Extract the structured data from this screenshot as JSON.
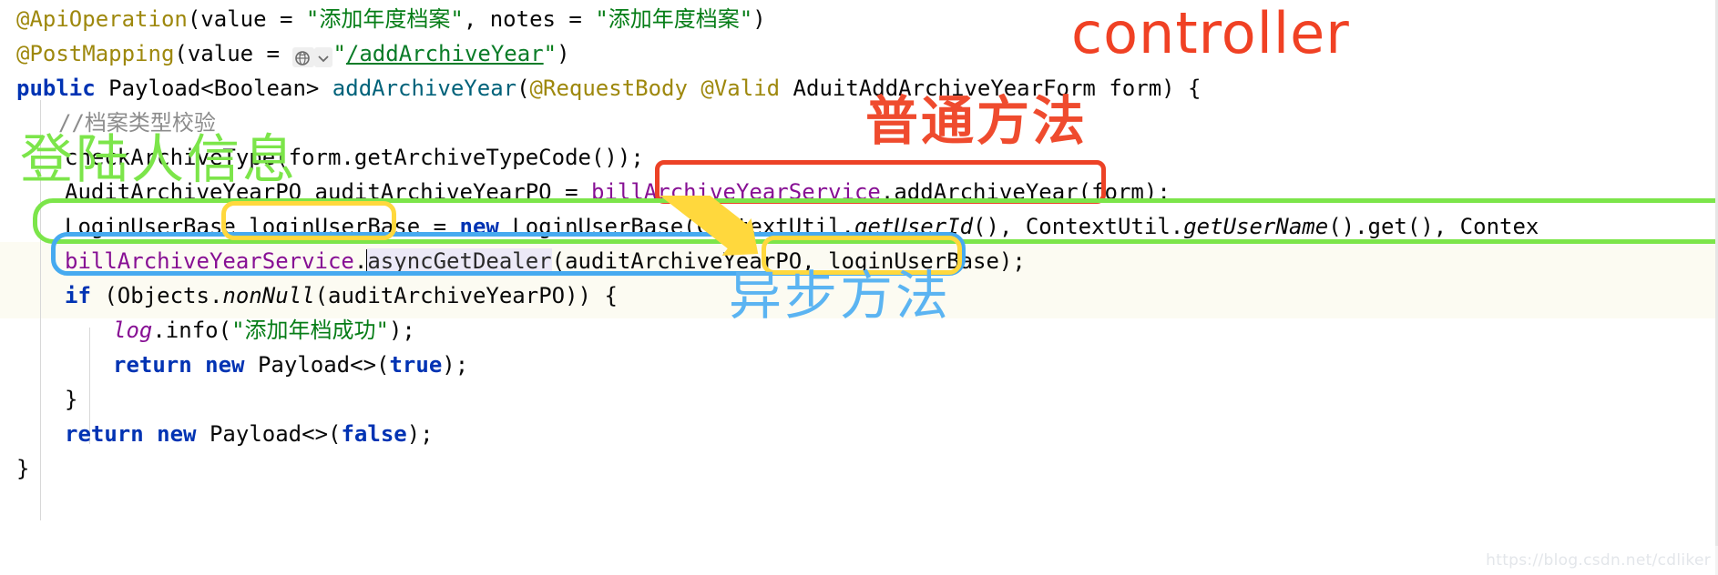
{
  "editor": {
    "language": "java",
    "code_lines": [
      {
        "id": "l1",
        "text": "@ApiOperation(value = \"添加年度档案\", notes = \"添加年度档案\")"
      },
      {
        "id": "l2",
        "text": "@PostMapping(value = \"/addArchiveYear\")"
      },
      {
        "id": "l3",
        "text": "public Payload<Boolean> addArchiveYear(@RequestBody @Valid AduitAddArchiveYearForm form) {"
      },
      {
        "id": "l4",
        "text": "//档案类型校验"
      },
      {
        "id": "l5",
        "text": "checkArchiveType(form.getArchiveTypeCode());"
      },
      {
        "id": "l6",
        "text": "AuditArchiveYearPO auditArchiveYearPO = billArchiveYearService.addArchiveYear(form);"
      },
      {
        "id": "l7",
        "text": "LoginUserBase loginUserBase = new LoginUserBase(ContextUtil.getUserId(), ContextUtil.getUserName().get(), Contex"
      },
      {
        "id": "l8",
        "text": "billArchiveYearService.asyncGetDealer(auditArchiveYearPO, loginUserBase);"
      },
      {
        "id": "l9",
        "text": "if (Objects.nonNull(auditArchiveYearPO)) {"
      },
      {
        "id": "l10",
        "text": "log.info(\"添加年档成功\");"
      },
      {
        "id": "l11",
        "text": "return new Payload<>(true);"
      },
      {
        "id": "l12",
        "text": "}"
      },
      {
        "id": "l13",
        "text": "return new Payload<>(false);"
      },
      {
        "id": "l14",
        "text": "}"
      }
    ],
    "tokens": {
      "ann_api_operation": "@ApiOperation",
      "ann_post_mapping": "@PostMapping",
      "kw_value": "value",
      "kw_notes": "notes",
      "str_add_archive_year_cn": "\"添加年度档案\"",
      "str_url_quote_open": "\"",
      "str_url": "/addArchiveYear",
      "str_url_quote_close": "\"",
      "kw_public": "public",
      "type_payload_boolean": "Payload<Boolean>",
      "method_add_archive_year": "addArchiveYear",
      "ann_request_body": "@RequestBody",
      "ann_valid": "@Valid",
      "type_form": "AduitAddArchiveYearForm",
      "param_form": "form",
      "comment_archive_type_check": "//档案类型校验",
      "call_check_archive_type": "checkArchiveType(form.getArchiveTypeCode());",
      "type_audit_po": "AuditArchiveYearPO",
      "var_audit_po": "auditArchiveYearPO",
      "field_service": "billArchiveYearService",
      "method_add_archive_year_call": ".addArchiveYear(form);",
      "type_login_user_base": "LoginUserBase",
      "var_login_user_base": "loginUserBase",
      "kw_new": "new",
      "ctor_login_user_base": "LoginUserBase(ContextUtil.",
      "method_get_user_id": "getUserId",
      "after_user_id": "(), ContextUtil.",
      "method_get_user_name": "getUserName",
      "after_user_name": "().get(), Contex",
      "method_async_get_dealer": "asyncGetDealer",
      "async_args": "(auditArchiveYearPO, loginUserBase);",
      "kw_if": "if",
      "objects_non_null_open": " (Objects.",
      "method_non_null": "nonNull",
      "non_null_args": "(auditArchiveYearPO)) {",
      "field_log": "log",
      "log_info_open": ".info(",
      "str_add_year_success": "\"添加年档成功\"",
      "log_info_close": ");",
      "kw_return": "return",
      "type_payload_diamond": "Payload<>(",
      "kw_true": "true",
      "kw_false": "false",
      "paren_semi": ");",
      "brace_close": "}"
    },
    "globe_icon": "globe-icon",
    "chevron_icon": "chevron-down-icon",
    "caret_visible": true
  },
  "annotations": [
    {
      "id": "a1",
      "name": "controller-label",
      "text": "controller",
      "color": "#f04124",
      "kind": "label"
    },
    {
      "id": "a2",
      "name": "ordinary-method-label",
      "text": "普通方法",
      "color": "#ef4b2e",
      "kind": "label"
    },
    {
      "id": "a3",
      "name": "login-user-info-label",
      "text": "登陆人信息",
      "color": "#7ce54a",
      "kind": "label"
    },
    {
      "id": "a4",
      "name": "async-method-label",
      "text": "异步方法",
      "color": "#5bb4f2",
      "kind": "label"
    },
    {
      "id": "a5",
      "name": "red-highlight-box",
      "text": "",
      "color": "#ec4226",
      "kind": "box"
    },
    {
      "id": "a6",
      "name": "green-highlight-box",
      "text": "",
      "color": "#7ce54a",
      "kind": "box"
    },
    {
      "id": "a7",
      "name": "blue-highlight-box",
      "text": "",
      "color": "#46aaf0",
      "kind": "box"
    },
    {
      "id": "a8",
      "name": "yellow-highlight-box-var",
      "text": "",
      "color": "#ffd83d",
      "kind": "box"
    },
    {
      "id": "a9",
      "name": "yellow-highlight-box-arg",
      "text": "",
      "color": "#ffd83d",
      "kind": "box"
    },
    {
      "id": "a10",
      "name": "yellow-arrow",
      "text": "",
      "color": "#ffd83d",
      "kind": "arrow"
    }
  ],
  "watermark": {
    "text": "https://blog.csdn.net/cdliker"
  },
  "colors": {
    "annotation_gold": "#9e880d",
    "keyword_blue": "#0033b3",
    "string_green": "#067d17",
    "field_purple": "#871094",
    "method_teal": "#00627a",
    "comment_grey": "#8c8c8c",
    "red": "#ec4226",
    "green": "#7ce54a",
    "blue": "#46aaf0",
    "yellow": "#ffd83d"
  }
}
